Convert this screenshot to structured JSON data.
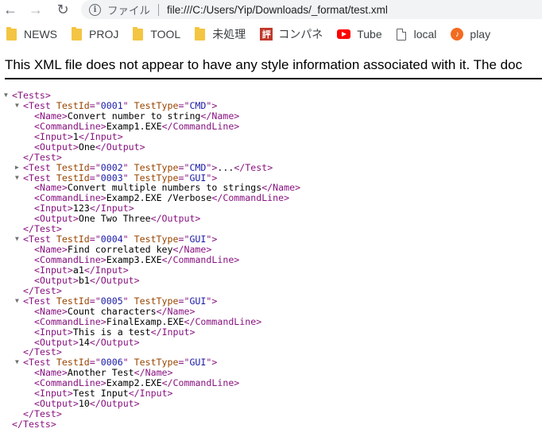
{
  "browser": {
    "back_icon": "←",
    "forward_icon": "→",
    "reload_icon": "↻",
    "info_icon": "i",
    "security_chip": "ファイル",
    "url": "file:///C:/Users/Yip/Downloads/_format/test.xml"
  },
  "bookmarks": [
    {
      "label": "NEWS",
      "icon": "folder-icon"
    },
    {
      "label": "PROJ",
      "icon": "folder-icon"
    },
    {
      "label": "TOOL",
      "icon": "folder-icon"
    },
    {
      "label": "未処理",
      "icon": "folder-icon"
    },
    {
      "label": "コンパネ",
      "icon": "hyo-icon",
      "glyph": "評"
    },
    {
      "label": "Tube",
      "icon": "youtube-icon"
    },
    {
      "label": "local",
      "icon": "page-icon"
    },
    {
      "label": "play",
      "icon": "play-icon",
      "glyph": "♪"
    }
  ],
  "banner": {
    "text": "This XML file does not appear to have any style information associated with it. The doc"
  },
  "xml": {
    "root": "Tests",
    "tests": [
      {
        "id": "0001",
        "type": "CMD",
        "collapsed": false,
        "name": "Convert number to string",
        "command": "Examp1.EXE",
        "input": "1",
        "output": "One"
      },
      {
        "id": "0002",
        "type": "CMD",
        "collapsed": true,
        "ellipsis": "..."
      },
      {
        "id": "0003",
        "type": "GUI",
        "collapsed": false,
        "name": "Convert multiple numbers to strings",
        "command": "Examp2.EXE /Verbose",
        "input": "123",
        "output": "One Two Three"
      },
      {
        "id": "0004",
        "type": "GUI",
        "collapsed": false,
        "name": "Find correlated key",
        "command": "Examp3.EXE",
        "input": "a1",
        "output": "b1"
      },
      {
        "id": "0005",
        "type": "GUI",
        "collapsed": false,
        "name": "Count characters",
        "command": "FinalExamp.EXE",
        "input": "This is a test",
        "output": "14"
      },
      {
        "id": "0006",
        "type": "GUI",
        "collapsed": false,
        "name": "Another Test",
        "command": "Examp2.EXE",
        "input": "Test Input",
        "output": "10"
      }
    ]
  }
}
